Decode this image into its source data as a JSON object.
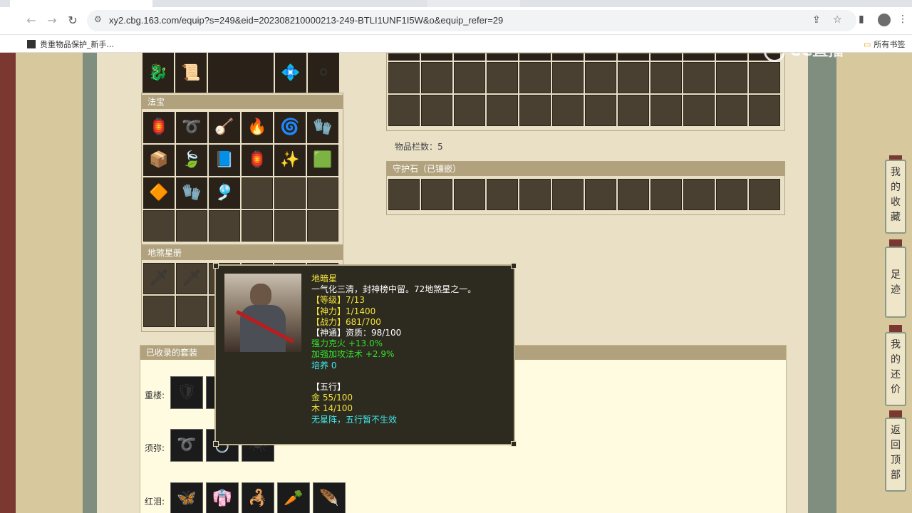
{
  "browser": {
    "url": "xy2.cbg.163.com/equip?s=249&eid=202308210000213-249-BTLI1UNF1I5W&o&equip_refer=29",
    "bookmarks": [
      {
        "label": "贵重物品保护_新手..."
      },
      {
        "label": "所有书签"
      }
    ]
  },
  "watermark": "CC直播",
  "fabao": {
    "title": "法宝",
    "rows": [
      [
        "🏮",
        "➰",
        "🪕",
        "🔥",
        "🌀",
        "🧤"
      ],
      [
        "📦",
        "🍃",
        "📘",
        "🏮",
        "✨",
        "🟩"
      ],
      [
        "🔶",
        "🧤",
        "🎐",
        "",
        "",
        ""
      ],
      [
        "",
        "",
        "",
        "",
        "",
        ""
      ]
    ]
  },
  "top_items": [
    "🐉",
    "📜",
    "",
    "💠",
    "⚪"
  ],
  "disha": {
    "title": "地煞星册",
    "items": [
      "🗡",
      "🗡"
    ]
  },
  "inventory": {
    "count_label": "物品栏数：5"
  },
  "guard_stone": {
    "title": "守护石（已镶嵌）"
  },
  "suits": {
    "title": "已收录的套装",
    "rows": [
      {
        "label": "重楼:",
        "icons": [
          "🛡",
          ""
        ]
      },
      {
        "label": "须弥:",
        "icons": [
          "➰",
          "💍",
          "🕷"
        ]
      },
      {
        "label": "红泪:",
        "icons": [
          "🦋",
          "👘",
          "🦂",
          "🥕",
          "🪶"
        ]
      }
    ]
  },
  "sidebar": [
    {
      "label": "我的收藏",
      "chars": [
        "我",
        "的",
        "收",
        "藏"
      ]
    },
    {
      "label": "足迹",
      "chars": [
        "足",
        "迹"
      ]
    },
    {
      "label": "我的还价",
      "chars": [
        "我",
        "的",
        "还",
        "价"
      ]
    },
    {
      "label": "返回顶部",
      "chars": [
        "返",
        "回",
        "顶",
        "部"
      ]
    }
  ],
  "tooltip": {
    "name": "地暗星",
    "desc": "一气化三清，封神榜中留。72地煞星之一。",
    "lines": [
      {
        "text": "【等级】7/13",
        "color": "yellow"
      },
      {
        "text": "【神力】1/1400",
        "color": "yellow"
      },
      {
        "text": "【战力】681/700",
        "color": "yellow"
      },
      {
        "text": "【神通】资质：98/100",
        "color": "white"
      },
      {
        "text": "强力克火 +13.0%",
        "color": "green"
      },
      {
        "text": "加强加攻法术 +2.9%",
        "color": "green"
      },
      {
        "text": "培养 0",
        "color": "cyan"
      },
      {
        "text": " ",
        "color": "white"
      },
      {
        "text": "【五行】",
        "color": "white"
      },
      {
        "text": "金 55/100",
        "color": "yellow"
      },
      {
        "text": "木 14/100",
        "color": "yellow"
      },
      {
        "text": "无星阵，五行暂不生效",
        "color": "cyan"
      }
    ]
  }
}
